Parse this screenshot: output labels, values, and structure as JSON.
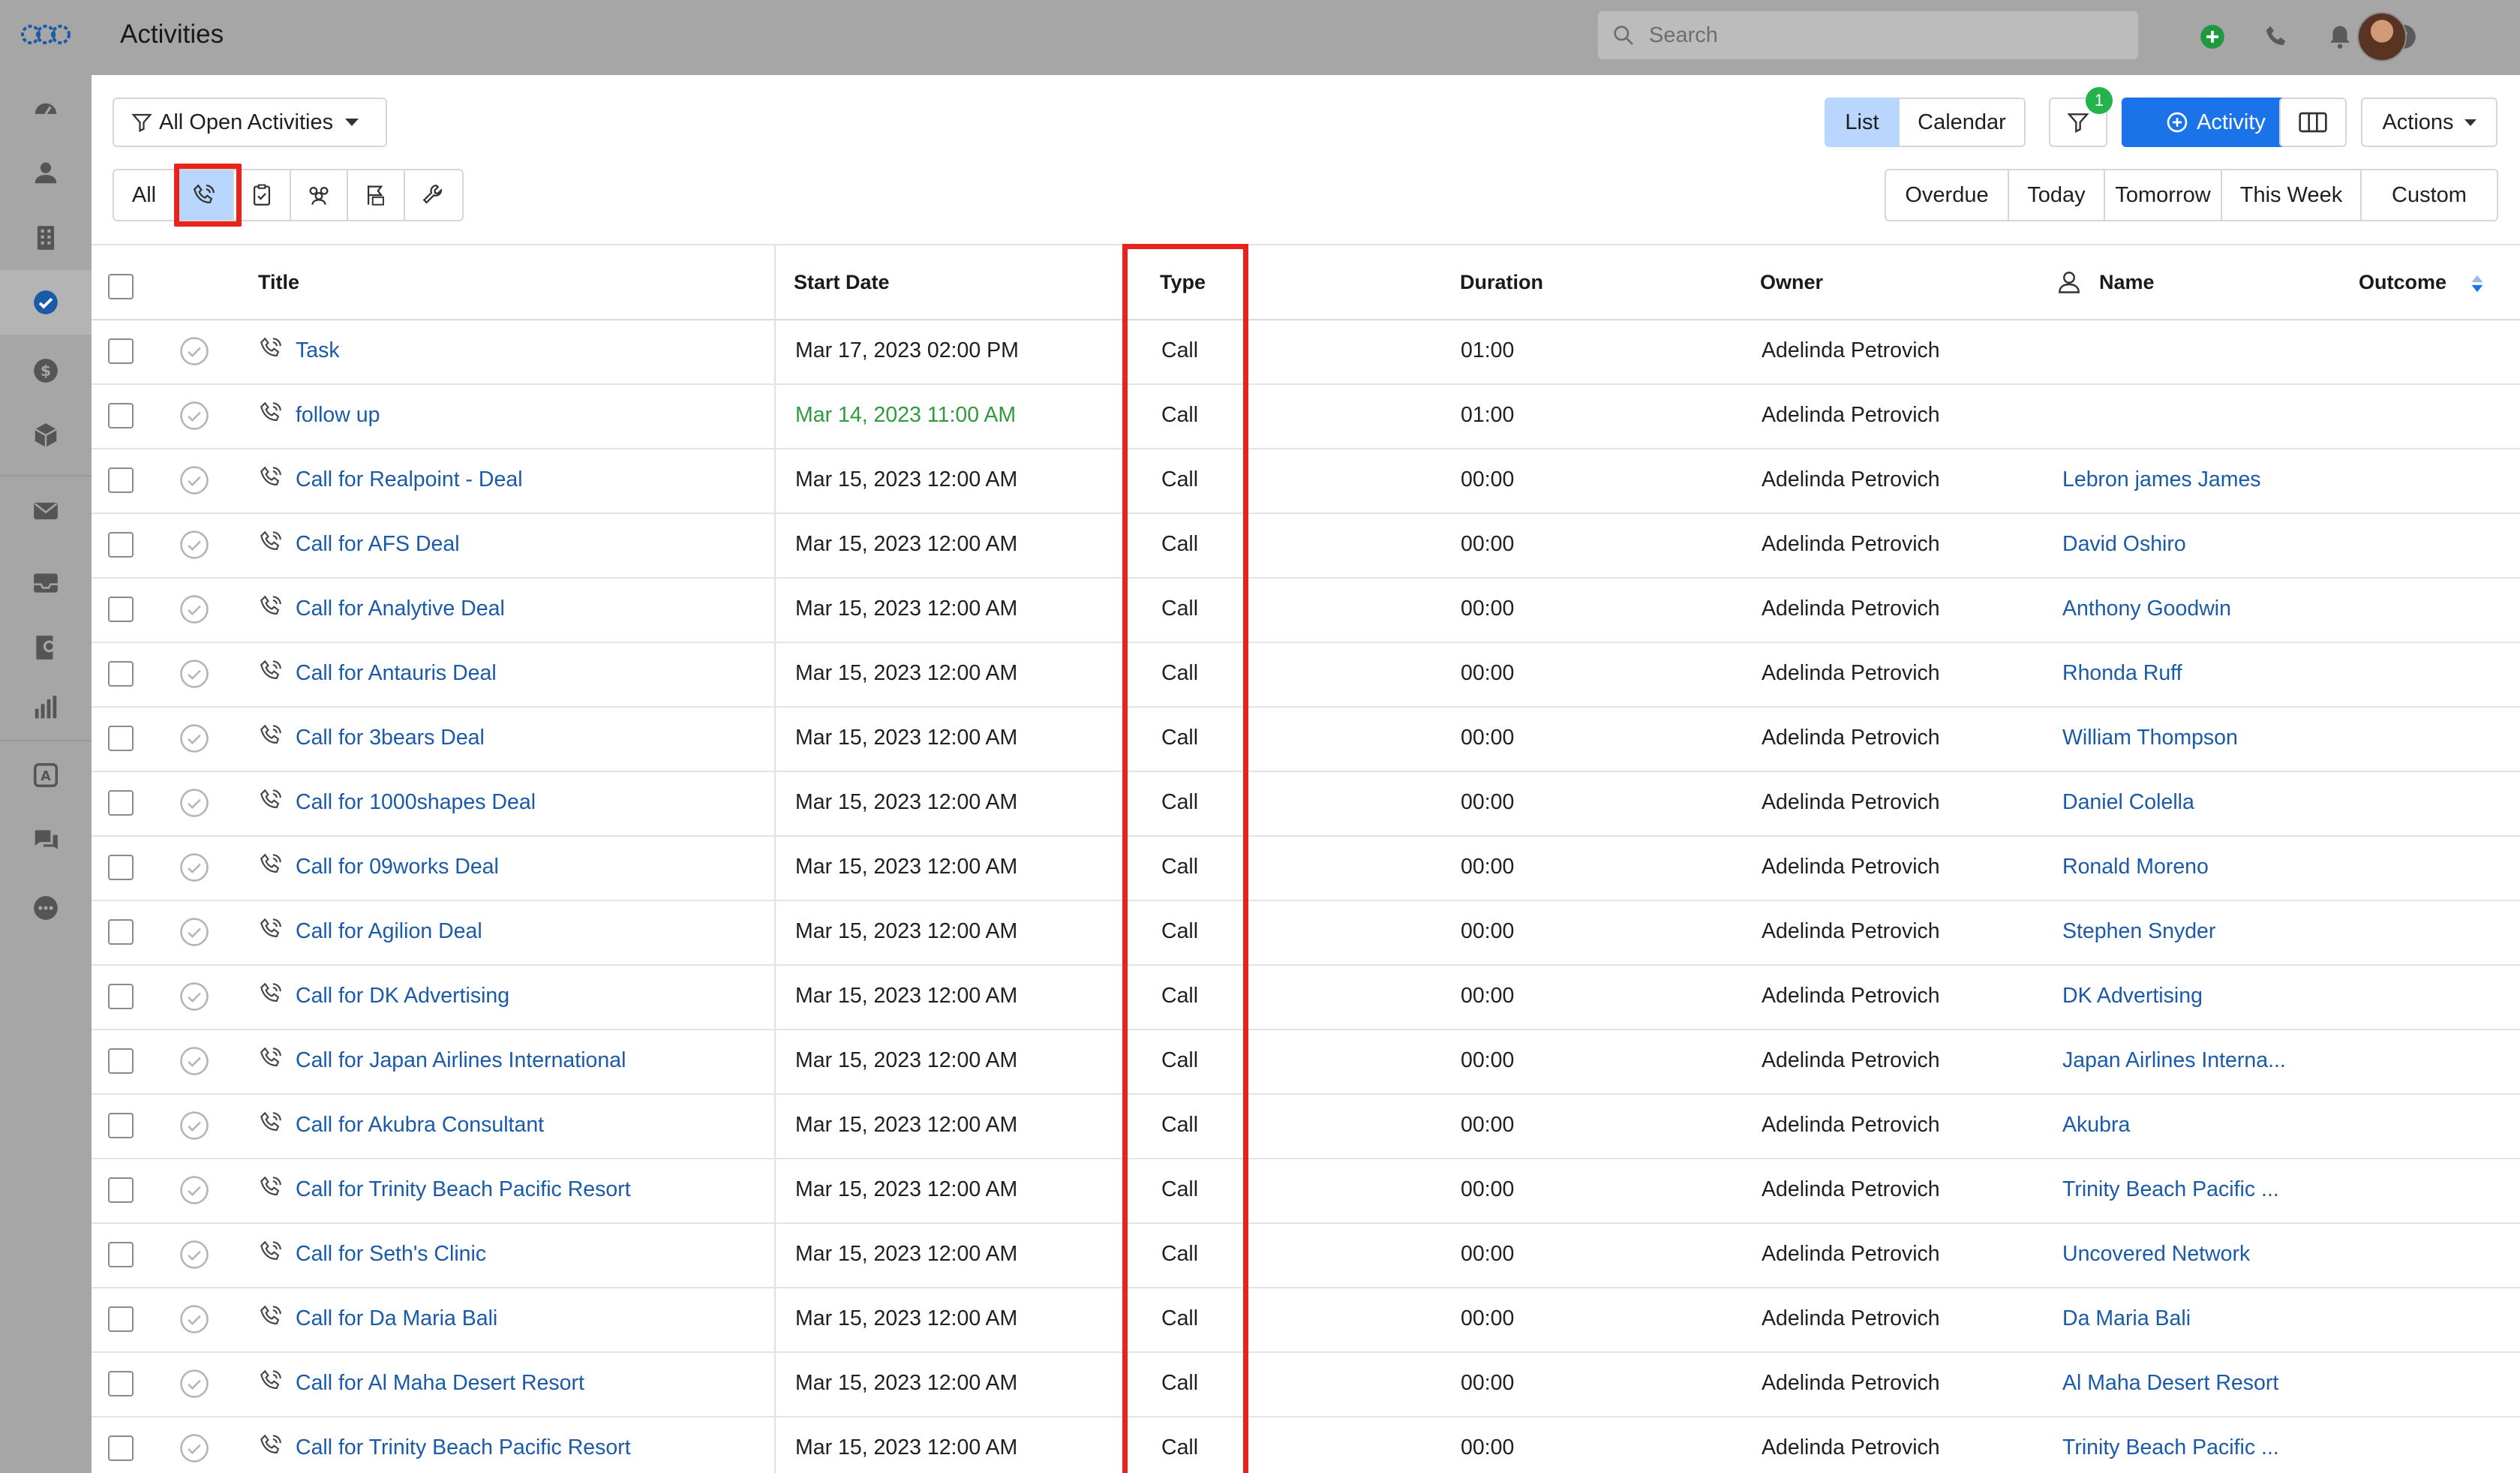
{
  "app": {
    "title": "Activities"
  },
  "search": {
    "placeholder": "Search"
  },
  "toolbar": {
    "view_filter": "All Open Activities",
    "view_list": "List",
    "view_calendar": "Calendar",
    "filter_badge": "1",
    "add_activity": "Activity",
    "actions": "Actions"
  },
  "type_filters": {
    "all": "All",
    "icons": [
      "call-icon",
      "task-icon",
      "meeting-icon",
      "deadline-icon",
      "wrench-icon"
    ],
    "selected": "call-icon"
  },
  "date_filters": [
    "Overdue",
    "Today",
    "Tomorrow",
    "This Week",
    "Custom"
  ],
  "columns": {
    "title": "Title",
    "start_date": "Start Date",
    "type": "Type",
    "duration": "Duration",
    "owner": "Owner",
    "name": "Name",
    "outcome": "Outcome"
  },
  "rows": [
    {
      "title": "Task",
      "start_date": "Mar 17, 2023 02:00 PM",
      "type": "Call",
      "duration": "01:00",
      "owner": "Adelinda Petrovich",
      "name": ""
    },
    {
      "title": "follow up",
      "start_date": "Mar 14, 2023 11:00 AM",
      "type": "Call",
      "duration": "01:00",
      "owner": "Adelinda Petrovich",
      "name": ""
    },
    {
      "title": "Call for Realpoint - Deal",
      "start_date": "Mar 15, 2023 12:00 AM",
      "type": "Call",
      "duration": "00:00",
      "owner": "Adelinda Petrovich",
      "name": "Lebron james James"
    },
    {
      "title": "Call for AFS Deal",
      "start_date": "Mar 15, 2023 12:00 AM",
      "type": "Call",
      "duration": "00:00",
      "owner": "Adelinda Petrovich",
      "name": "David Oshiro"
    },
    {
      "title": "Call for Analytive Deal",
      "start_date": "Mar 15, 2023 12:00 AM",
      "type": "Call",
      "duration": "00:00",
      "owner": "Adelinda Petrovich",
      "name": "Anthony Goodwin"
    },
    {
      "title": "Call for Antauris Deal",
      "start_date": "Mar 15, 2023 12:00 AM",
      "type": "Call",
      "duration": "00:00",
      "owner": "Adelinda Petrovich",
      "name": "Rhonda Ruff"
    },
    {
      "title": "Call for 3bears Deal",
      "start_date": "Mar 15, 2023 12:00 AM",
      "type": "Call",
      "duration": "00:00",
      "owner": "Adelinda Petrovich",
      "name": "William Thompson"
    },
    {
      "title": "Call for 1000shapes Deal",
      "start_date": "Mar 15, 2023 12:00 AM",
      "type": "Call",
      "duration": "00:00",
      "owner": "Adelinda Petrovich",
      "name": "Daniel Colella"
    },
    {
      "title": "Call for 09works Deal",
      "start_date": "Mar 15, 2023 12:00 AM",
      "type": "Call",
      "duration": "00:00",
      "owner": "Adelinda Petrovich",
      "name": "Ronald Moreno"
    },
    {
      "title": "Call for Agilion Deal",
      "start_date": "Mar 15, 2023 12:00 AM",
      "type": "Call",
      "duration": "00:00",
      "owner": "Adelinda Petrovich",
      "name": "Stephen Snyder"
    },
    {
      "title": "Call for DK Advertising",
      "start_date": "Mar 15, 2023 12:00 AM",
      "type": "Call",
      "duration": "00:00",
      "owner": "Adelinda Petrovich",
      "name": "DK Advertising"
    },
    {
      "title": "Call for Japan Airlines International",
      "start_date": "Mar 15, 2023 12:00 AM",
      "type": "Call",
      "duration": "00:00",
      "owner": "Adelinda Petrovich",
      "name": "Japan Airlines Interna..."
    },
    {
      "title": "Call for Akubra Consultant",
      "start_date": "Mar 15, 2023 12:00 AM",
      "type": "Call",
      "duration": "00:00",
      "owner": "Adelinda Petrovich",
      "name": "Akubra"
    },
    {
      "title": "Call for Trinity Beach Pacific Resort",
      "start_date": "Mar 15, 2023 12:00 AM",
      "type": "Call",
      "duration": "00:00",
      "owner": "Adelinda Petrovich",
      "name": "Trinity Beach Pacific ..."
    },
    {
      "title": "Call for Seth's Clinic",
      "start_date": "Mar 15, 2023 12:00 AM",
      "type": "Call",
      "duration": "00:00",
      "owner": "Adelinda Petrovich",
      "name": "Uncovered Network"
    },
    {
      "title": "Call for Da Maria Bali",
      "start_date": "Mar 15, 2023 12:00 AM",
      "type": "Call",
      "duration": "00:00",
      "owner": "Adelinda Petrovich",
      "name": "Da Maria Bali"
    },
    {
      "title": "Call for Al Maha Desert Resort",
      "start_date": "Mar 15, 2023 12:00 AM",
      "type": "Call",
      "duration": "00:00",
      "owner": "Adelinda Petrovich",
      "name": "Al Maha Desert Resort"
    },
    {
      "title": "Call for Trinity Beach Pacific Resort",
      "start_date": "Mar 15, 2023 12:00 AM",
      "type": "Call",
      "duration": "00:00",
      "owner": "Adelinda Petrovich",
      "name": "Trinity Beach Pacific ..."
    }
  ],
  "overdue_row_index": 1,
  "colors": {
    "accent": "#1a73e8",
    "selected_bg": "#b9d6ff",
    "link": "#1a5aa8",
    "highlight": "#e8231c",
    "badge": "#23b34a",
    "upcoming_date": "#2e9b3f"
  },
  "sidebar": {
    "items": [
      "dashboard-icon",
      "contacts-icon",
      "companies-icon",
      "activities-icon",
      "deals-icon",
      "products-icon",
      "email-icon",
      "inbox-icon",
      "campaigns-icon",
      "reports-icon",
      "automation-icon",
      "chat-icon",
      "more-icon"
    ],
    "active": "activities-icon"
  }
}
